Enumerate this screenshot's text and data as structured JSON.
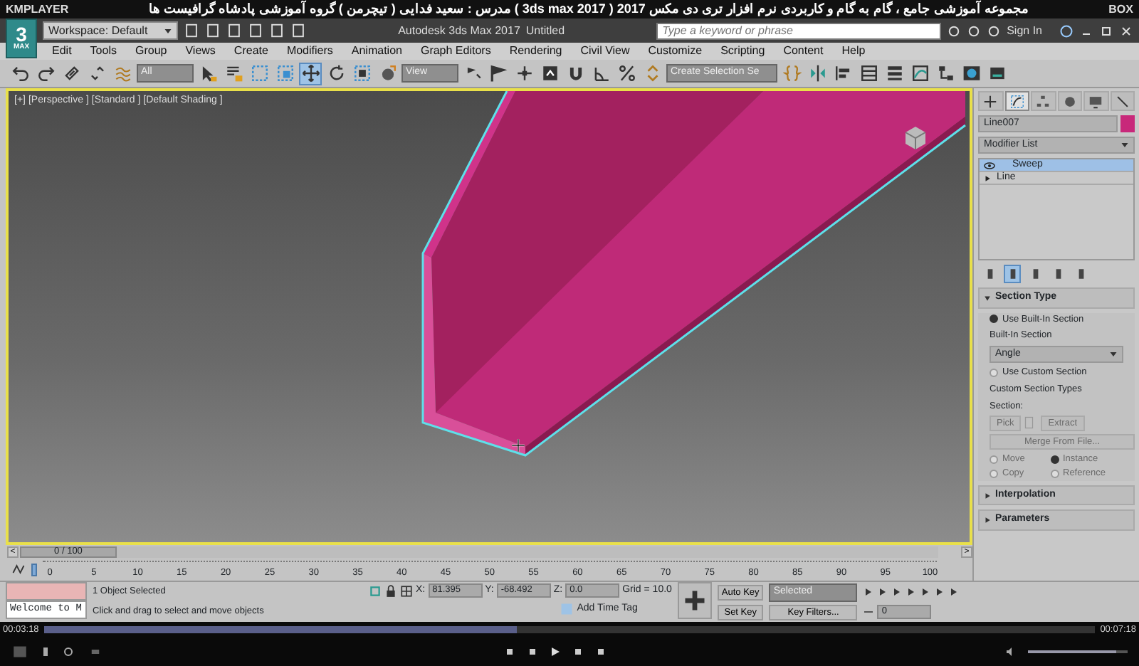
{
  "player": {
    "brand": "KMPLAYER",
    "title": "مجموعه آموزشی جامع ، گام به گام و کاربردی نرم افزار تری دی مکس 2017 ( 3ds max 2017 ) مدرس : سعید فدایی ( تیچرمن ) گروه آموزشی پادشاه گرافیست ها",
    "badge": "BOX",
    "elapsed": "00:03:18",
    "total": "00:07:18",
    "progress": {
      "level": 0.45
    },
    "volume": {
      "level": 0.88
    }
  },
  "app": {
    "logo": "3",
    "logo_caption": "MAX",
    "workspace": "Workspace: Default",
    "title": "Autodesk 3ds Max 2017",
    "document": "Untitled",
    "search": {
      "placeholder": "Type a keyword or phrase"
    },
    "sign_in": "Sign In"
  },
  "menu": [
    "Edit",
    "Tools",
    "Group",
    "Views",
    "Create",
    "Modifiers",
    "Animation",
    "Graph Editors",
    "Rendering",
    "Civil View",
    "Customize",
    "Scripting",
    "Content",
    "Help"
  ],
  "toolbar": [
    {
      "kind": "tool",
      "selected": false
    },
    {
      "kind": "tool",
      "selected": false
    },
    {
      "kind": "tool",
      "selected": false
    },
    {
      "kind": "tool",
      "selected": false
    },
    {
      "kind": "tool",
      "selected": false
    },
    {
      "kind": "dropdown",
      "value": "All"
    },
    {
      "kind": "tool",
      "selected": false
    },
    {
      "kind": "tool",
      "selected": false
    },
    {
      "kind": "tool",
      "selected": false
    },
    {
      "kind": "tool",
      "selected": false
    },
    {
      "kind": "tool",
      "selected": true
    },
    {
      "kind": "tool",
      "selected": false
    },
    {
      "kind": "tool",
      "selected": false
    },
    {
      "kind": "tool",
      "selected": false
    },
    {
      "kind": "dropdown",
      "value": "View"
    },
    {
      "kind": "tool",
      "selected": false
    },
    {
      "kind": "tool",
      "selected": false
    },
    {
      "kind": "tool",
      "selected": false
    },
    {
      "kind": "tool",
      "selected": false
    },
    {
      "kind": "tool",
      "selected": false
    },
    {
      "kind": "tool",
      "selected": false
    },
    {
      "kind": "tool",
      "selected": false
    },
    {
      "kind": "tool",
      "selected": false
    },
    {
      "kind": "dropdown",
      "value": "Create Selection Se"
    },
    {
      "kind": "tool",
      "selected": false
    },
    {
      "kind": "tool",
      "selected": false
    },
    {
      "kind": "tool",
      "selected": false
    },
    {
      "kind": "tool",
      "selected": false
    },
    {
      "kind": "tool",
      "selected": false
    },
    {
      "kind": "tool",
      "selected": false
    },
    {
      "kind": "tool",
      "selected": false
    },
    {
      "kind": "tool",
      "selected": false
    },
    {
      "kind": "tool",
      "selected": false
    }
  ],
  "viewport": {
    "labels": [
      "[+]",
      "[Perspective ]",
      "[Standard ]",
      "[Default Shading ]"
    ]
  },
  "command_panel": {
    "tabs": [
      {
        "selected": false
      },
      {
        "selected": true
      },
      {
        "selected": false
      },
      {
        "selected": false
      },
      {
        "selected": false
      },
      {
        "selected": false
      }
    ],
    "object_name": "Line007",
    "modifier_list": "Modifier List",
    "stack": [
      {
        "label": "Sweep",
        "selected": true,
        "expandable": false
      },
      {
        "label": "Line",
        "selected": false,
        "expandable": true
      }
    ],
    "stack_tools": [
      {
        "selected": false
      },
      {
        "selected": true
      },
      {
        "selected": false
      },
      {
        "selected": false
      },
      {
        "selected": false
      }
    ],
    "rollouts": [
      {
        "title": "Section Type",
        "expanded": true
      },
      {
        "title": "Interpolation",
        "expanded": false
      },
      {
        "title": "Parameters",
        "expanded": false
      }
    ],
    "section_type": {
      "use_builtin": {
        "label": "Use Built-In Section",
        "checked": true
      },
      "builtin_label": "Built-In Section",
      "builtin_value": "Angle",
      "use_custom": {
        "label": "Use Custom Section",
        "checked": false
      },
      "custom_label": "Custom Section Types",
      "section_label": "Section:",
      "pick": {
        "label": "Pick",
        "disabled": true
      },
      "extract": {
        "label": "Extract",
        "disabled": true
      },
      "merge": {
        "label": "Merge From File...",
        "disabled": true
      },
      "modes": [
        {
          "label": "Move",
          "checked": false,
          "disabled": true
        },
        {
          "label": "Instance",
          "checked": true,
          "disabled": true
        },
        {
          "label": "Copy",
          "checked": false,
          "disabled": true
        },
        {
          "label": "Reference",
          "checked": false,
          "disabled": true
        }
      ]
    }
  },
  "time_slider": {
    "text": "0 / 100",
    "level": 0,
    "prev": "<",
    "next": ">"
  },
  "track_bar": {
    "ticks": [
      "0",
      "5",
      "10",
      "15",
      "20",
      "25",
      "30",
      "35",
      "40",
      "45",
      "50",
      "55",
      "60",
      "65",
      "70",
      "75",
      "80",
      "85",
      "90",
      "95",
      "100"
    ]
  },
  "status_bar": {
    "listener": "Welcome to M",
    "selection": "1 Object Selected",
    "prompt": "Click and drag to select and move objects",
    "coords": [
      {
        "label": "X:",
        "value": "81.395"
      },
      {
        "label": "Y:",
        "value": "-68.492"
      },
      {
        "label": "Z:",
        "value": "0.0"
      }
    ],
    "grid": "Grid = 10.0",
    "time_tag": "Add Time Tag",
    "auto_key": "Auto Key",
    "key_mode": "Selected",
    "set_key": "Set Key",
    "key_filters": "Key Filters...",
    "frame": "0"
  }
}
